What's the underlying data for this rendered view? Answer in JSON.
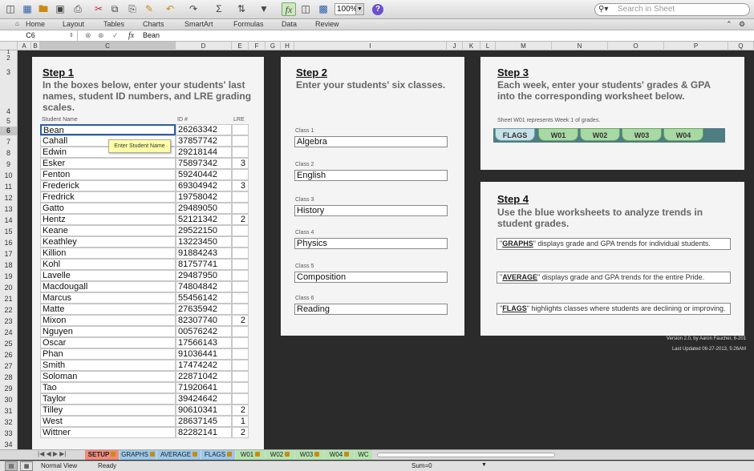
{
  "toolbar": {
    "zoom": "100%",
    "search_placeholder": "Search in Sheet",
    "icons": [
      "new-icon",
      "templates-icon",
      "open-icon",
      "save-icon",
      "print-icon",
      "cut-icon",
      "copy-icon",
      "paste-icon",
      "format-icon",
      "undo-icon",
      "redo-icon",
      "autosum-icon",
      "sort-icon",
      "filter-icon",
      "formula-builder-icon",
      "gallery-icon",
      "toolbox-icon",
      "help-icon"
    ]
  },
  "ribbon": {
    "home_icon": "home-icon",
    "tabs": [
      "Home",
      "Layout",
      "Tables",
      "Charts",
      "SmartArt",
      "Formulas",
      "Data",
      "Review"
    ]
  },
  "formula_bar": {
    "name_box": "C6",
    "fx_label": "fx",
    "content": "Bean"
  },
  "columns": [
    "A",
    "B",
    "C",
    "D",
    "E",
    "F",
    "G",
    "H",
    "I",
    "J",
    "K",
    "L",
    "M",
    "N",
    "O",
    "P",
    "Q"
  ],
  "rows": [
    "1",
    "2",
    "3",
    "4",
    "5",
    "6",
    "7",
    "8",
    "9",
    "10",
    "11",
    "12",
    "13",
    "14",
    "15",
    "16",
    "17",
    "18",
    "19",
    "20",
    "21",
    "22",
    "23",
    "24",
    "25",
    "26",
    "27",
    "28",
    "29",
    "30",
    "31",
    "32",
    "33",
    "34"
  ],
  "step1": {
    "title": "Step 1",
    "desc": "In the boxes below, enter your students' last names, student ID numbers, and    LRE grading scales.",
    "col_name": "Student Name",
    "col_id": "ID #",
    "col_lre": "LRE",
    "tooltip": "Enter Student Name",
    "students": [
      {
        "name": "Bean",
        "id": "26263342",
        "lre": ""
      },
      {
        "name": "Cahall",
        "id": "37857742",
        "lre": ""
      },
      {
        "name": "Edwin",
        "id": "29218144",
        "lre": ""
      },
      {
        "name": "Esker",
        "id": "75897342",
        "lre": "3"
      },
      {
        "name": "Fenton",
        "id": "59240442",
        "lre": ""
      },
      {
        "name": "Frederick",
        "id": "69304942",
        "lre": "3"
      },
      {
        "name": "Fredrick",
        "id": "19758042",
        "lre": ""
      },
      {
        "name": "Gatto",
        "id": "29489050",
        "lre": ""
      },
      {
        "name": "Hentz",
        "id": "52121342",
        "lre": "2"
      },
      {
        "name": "Keane",
        "id": "29522150",
        "lre": ""
      },
      {
        "name": "Keathley",
        "id": "13223450",
        "lre": ""
      },
      {
        "name": "Killion",
        "id": "91884243",
        "lre": ""
      },
      {
        "name": "Kohl",
        "id": "81757741",
        "lre": ""
      },
      {
        "name": "Lavelle",
        "id": "29487950",
        "lre": ""
      },
      {
        "name": "Macdougall",
        "id": "74804842",
        "lre": ""
      },
      {
        "name": "Marcus",
        "id": "55456142",
        "lre": ""
      },
      {
        "name": "Matte",
        "id": "27635942",
        "lre": ""
      },
      {
        "name": "Mixon",
        "id": "82307740",
        "lre": "2"
      },
      {
        "name": "Nguyen",
        "id": "00576242",
        "lre": ""
      },
      {
        "name": "Oscar",
        "id": "17566143",
        "lre": ""
      },
      {
        "name": "Phan",
        "id": "91036441",
        "lre": ""
      },
      {
        "name": "Smith",
        "id": "17474242",
        "lre": ""
      },
      {
        "name": "Soloman",
        "id": "22871042",
        "lre": ""
      },
      {
        "name": "Tao",
        "id": "71920641",
        "lre": ""
      },
      {
        "name": "Taylor",
        "id": "39424642",
        "lre": ""
      },
      {
        "name": "Tilley",
        "id": "90610341",
        "lre": "2"
      },
      {
        "name": "West",
        "id": "28637145",
        "lre": "1"
      },
      {
        "name": "Wittner",
        "id": "82282141",
        "lre": "2"
      }
    ]
  },
  "step2": {
    "title": "Step 2",
    "desc": "Enter your students' six classes.",
    "classes": [
      {
        "label": "Class 1",
        "value": "Algebra"
      },
      {
        "label": "Class 2",
        "value": "English"
      },
      {
        "label": "Class 3",
        "value": "History"
      },
      {
        "label": "Class 4",
        "value": "Physics"
      },
      {
        "label": "Class 5",
        "value": "Composition"
      },
      {
        "label": "Class 6",
        "value": "Reading"
      }
    ]
  },
  "step3": {
    "title": "Step 3",
    "desc": "Each week, enter your students' grades & GPA into the corresponding worksheet below.",
    "note": "Sheet W01 represents Week 1 of grades.",
    "tabs": [
      "FLAGS",
      "W01",
      "W02",
      "W03",
      "W04"
    ]
  },
  "step4": {
    "title": "Step 4",
    "desc": "Use the blue worksheets to analyze trends in student grades.",
    "items": [
      {
        "key": "GRAPHS",
        "text": "\" displays grade and GPA trends for individual students."
      },
      {
        "key": "AVERAGE",
        "text": "\" displays grade and GPA trends for the entire Pride."
      },
      {
        "key": "FLAGS",
        "text": "\" highlights classes where students are declining or improving."
      }
    ]
  },
  "credits": {
    "version": "Version 2.0, by Aaron Faucher, 6-201",
    "updated": "Last Updated 06-27-2013, 5:26AM"
  },
  "sheet_tabs": [
    "SETUP",
    "GRAPHS",
    "AVERAGE",
    "FLAGS",
    "W01",
    "W02",
    "W03",
    "W04",
    "WC"
  ],
  "status": {
    "view": "Normal View",
    "state": "Ready",
    "sum": "Sum=0"
  },
  "colors": {
    "setup_tab": "#f08a7a",
    "blue_tabs": "#9cc9ea",
    "green_tabs": "#b6e3b0",
    "accent": "#2a5ea8"
  }
}
